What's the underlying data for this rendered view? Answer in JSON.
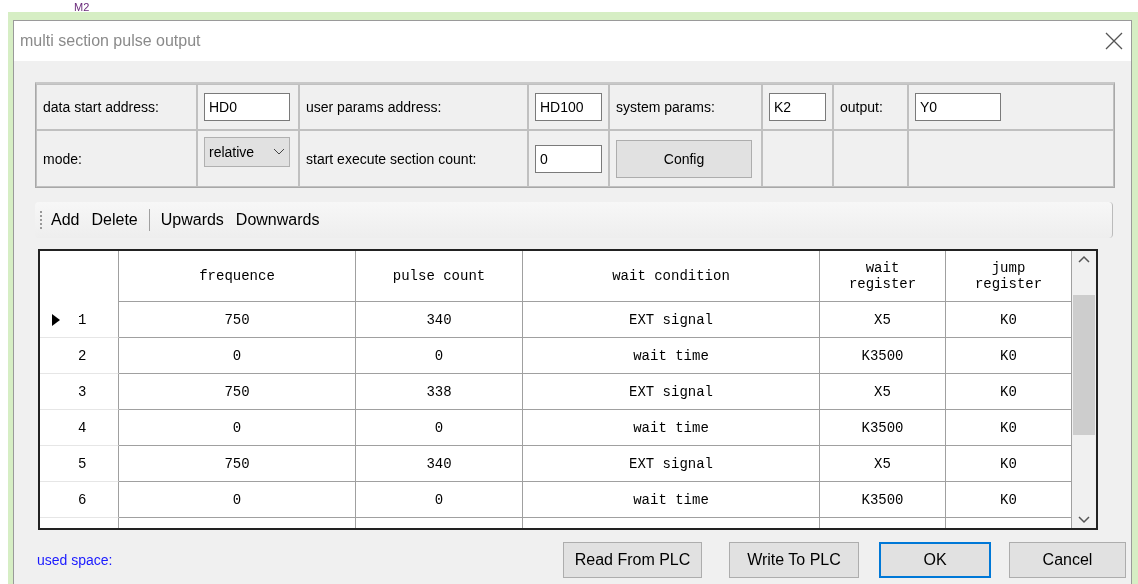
{
  "backdrop": {
    "label": "M2"
  },
  "window": {
    "title": "multi section pulse output"
  },
  "params": [
    [
      {
        "kind": "label",
        "text": "data start address:"
      },
      {
        "kind": "field",
        "value": "HD0"
      },
      {
        "kind": "label",
        "text": "user params address:"
      },
      {
        "kind": "field",
        "value": "HD100"
      },
      {
        "kind": "label",
        "text": "system params:"
      },
      {
        "kind": "field",
        "value": "K2"
      },
      {
        "kind": "label",
        "text": "output:"
      },
      {
        "kind": "field",
        "value": "Y0"
      }
    ],
    [
      {
        "kind": "label",
        "text": "mode:"
      },
      {
        "kind": "dropdown",
        "value": "relative"
      },
      {
        "kind": "label",
        "text": "start execute section count:"
      },
      {
        "kind": "field",
        "value": "0"
      },
      {
        "kind": "button",
        "text": "Config"
      },
      {
        "kind": "empty"
      },
      {
        "kind": "empty"
      },
      {
        "kind": "empty"
      }
    ]
  ],
  "toolbar": [
    {
      "kind": "button",
      "text": "Add"
    },
    {
      "kind": "button",
      "text": "Delete"
    },
    {
      "kind": "separator"
    },
    {
      "kind": "button",
      "text": "Upwards"
    },
    {
      "kind": "button",
      "text": "Downwards"
    }
  ],
  "table": {
    "columns": [
      "frequence",
      "pulse count",
      "wait condition",
      "wait\nregister",
      "jump\nregister"
    ],
    "rows": [
      {
        "index": "1",
        "selected": true,
        "cells": [
          "750",
          "340",
          "EXT signal",
          "X5",
          "K0"
        ]
      },
      {
        "index": "2",
        "selected": false,
        "cells": [
          "0",
          "0",
          "wait time",
          "K3500",
          "K0"
        ]
      },
      {
        "index": "3",
        "selected": false,
        "cells": [
          "750",
          "338",
          "EXT signal",
          "X5",
          "K0"
        ]
      },
      {
        "index": "4",
        "selected": false,
        "cells": [
          "0",
          "0",
          "wait time",
          "K3500",
          "K0"
        ]
      },
      {
        "index": "5",
        "selected": false,
        "cells": [
          "750",
          "340",
          "EXT signal",
          "X5",
          "K0"
        ]
      },
      {
        "index": "6",
        "selected": false,
        "cells": [
          "0",
          "0",
          "wait time",
          "K3500",
          "K0"
        ]
      }
    ]
  },
  "footer": {
    "used_space": "used space:",
    "buttons": [
      {
        "text": "Read From PLC",
        "default": false
      },
      {
        "text": "Write To PLC",
        "default": false
      },
      {
        "text": "OK",
        "default": true
      },
      {
        "text": "Cancel",
        "default": false
      }
    ]
  }
}
